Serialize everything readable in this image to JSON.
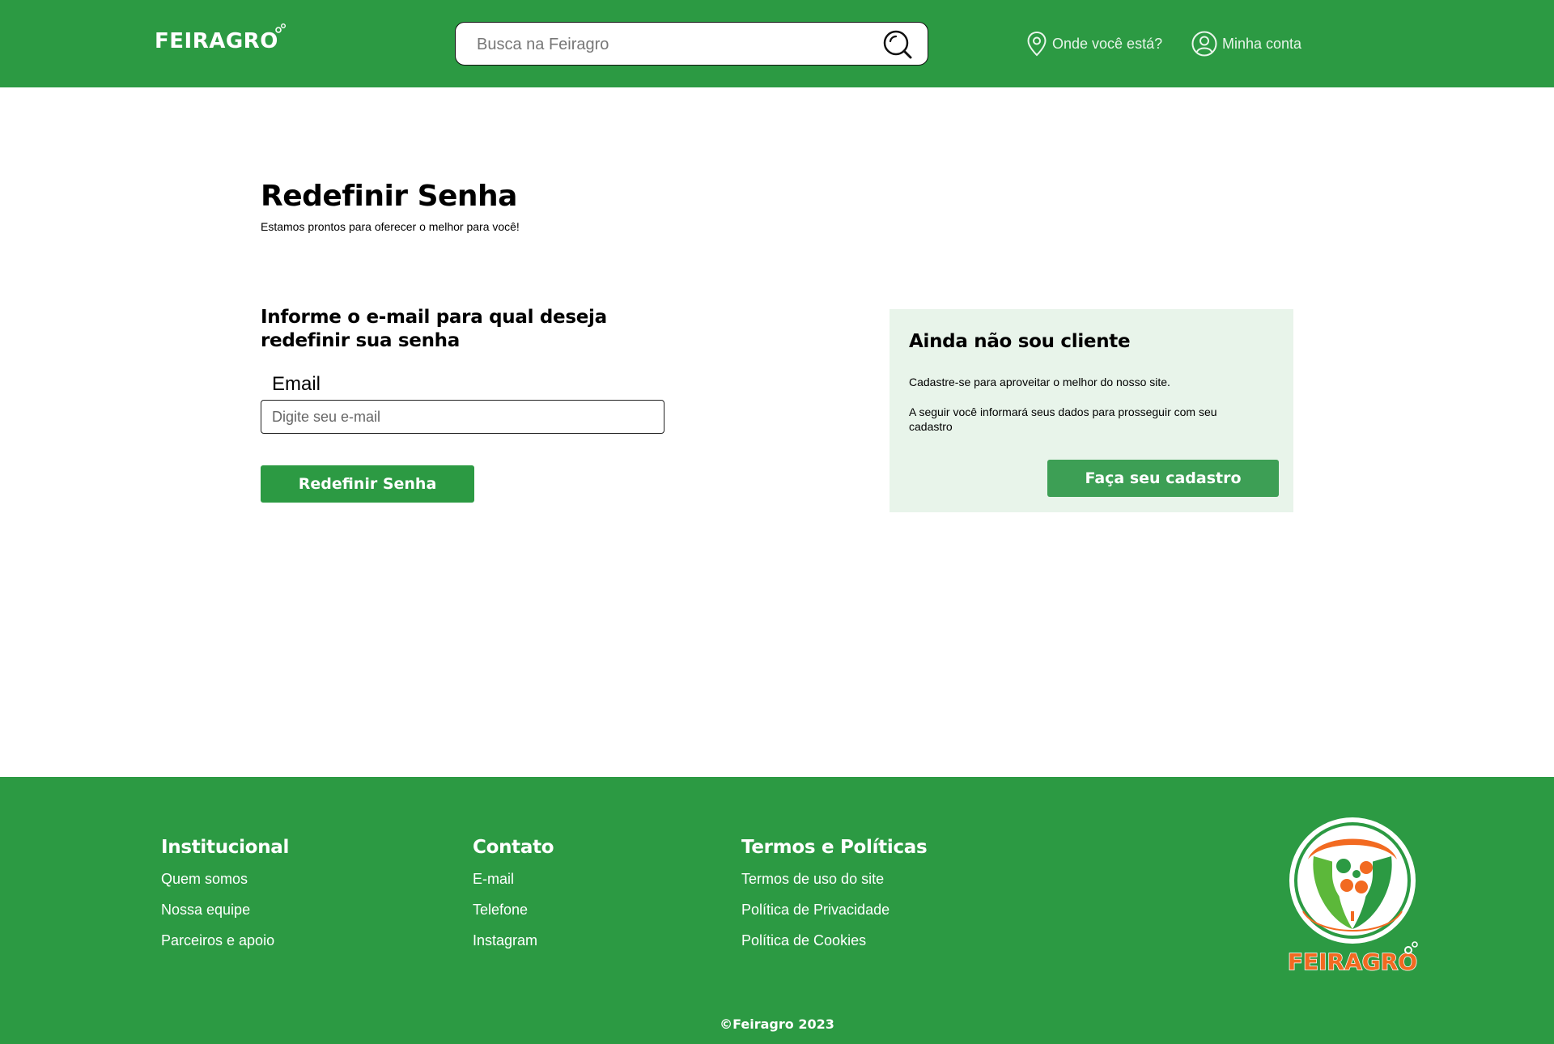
{
  "header": {
    "logo_text": "FEIRAGRO",
    "search_placeholder": "Busca na Feiragro",
    "location_label": "Onde você está?",
    "account_label": "Minha conta"
  },
  "main": {
    "title": "Redefinir Senha",
    "subtitle": "Estamos prontos para oferecer o melhor para você!",
    "form": {
      "heading": "Informe o e-mail para qual deseja redefinir sua senha",
      "email_label": "Email",
      "email_placeholder": "Digite seu e-mail",
      "email_value": "",
      "submit_label": "Redefinir Senha"
    },
    "signup_card": {
      "title": "Ainda não sou cliente",
      "paragraph1": "Cadastre-se para aproveitar o melhor do nosso site.",
      "paragraph2": "A seguir você informará seus dados para prosseguir com seu cadastro",
      "button_label": "Faça seu cadastro"
    }
  },
  "footer": {
    "columns": [
      {
        "title": "Institucional",
        "links": [
          "Quem somos",
          "Nossa equipe",
          "Parceiros e apoio"
        ]
      },
      {
        "title": "Contato",
        "links": [
          "E-mail",
          "Telefone",
          "Instagram"
        ]
      },
      {
        "title": "Termos e Políticas",
        "links": [
          "Termos de uso do site",
          "Política de Privacidade",
          "Política de Cookies"
        ]
      }
    ],
    "logo_text": "FEIRAGRO",
    "copyright": "©Feiragro 2023"
  },
  "colors": {
    "brand_green": "#2c9a43",
    "card_background": "#e8f4ea",
    "logo_orange": "#f26a21"
  },
  "icons": {
    "search": "search-icon",
    "location": "location-pin-icon",
    "account": "user-circle-icon"
  }
}
